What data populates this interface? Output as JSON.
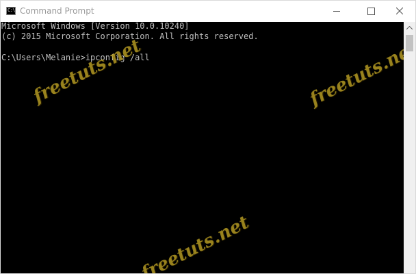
{
  "window": {
    "title": "Command Prompt",
    "icon_text": "C:\\",
    "controls": [
      "minimize-icon",
      "maximize-icon",
      "close-icon"
    ]
  },
  "console": {
    "background": "#000000",
    "text_color": "#c0c0c0",
    "lines": [
      "Microsoft Windows [Version 10.0.10240]",
      "(c) 2015 Microsoft Corporation. All rights reserved.",
      "C:\\Users\\Melanie>ipconfig /all"
    ]
  },
  "watermarks": [
    "freetuts.net",
    "freetuts.net",
    "freetuts.net"
  ]
}
